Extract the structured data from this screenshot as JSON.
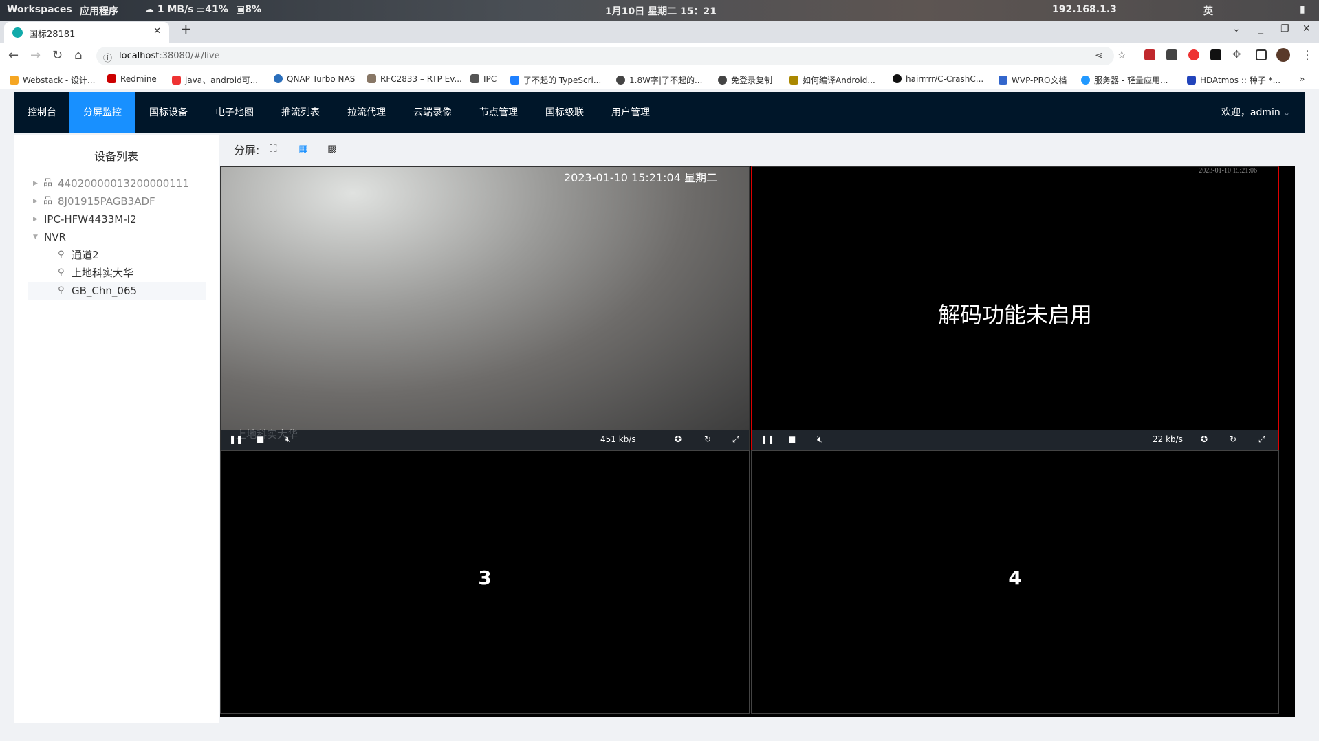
{
  "system_bar": {
    "workspaces": "Workspaces",
    "apps": "应用程序",
    "net": "1 MB/s",
    "cpu": "41%",
    "mem": "8%",
    "clock": "1月10日 星期二 15：21",
    "ip": "192.168.1.3",
    "ime": "英"
  },
  "browser": {
    "tab_title": "国标28181",
    "url_host": "localhost",
    "url_rest": ":38080/#/live",
    "bookmarks": [
      "Webstack - 设计...",
      "Redmine",
      "java、android可...",
      "QNAP Turbo NAS",
      "RFC2833 – RTP Ev...",
      "IPC",
      "了不起的 TypeScri...",
      "1.8W字|了不起的...",
      "免登录复制",
      "如何编译Android...",
      "hairrrrr/C-CrashC...",
      "WVP-PRO文档",
      "服务器 - 轻量应用...",
      "HDAtmos :: 种子 *..."
    ],
    "bookmarks_more": "»"
  },
  "nav": {
    "items": [
      "控制台",
      "分屏监控",
      "国标设备",
      "电子地图",
      "推流列表",
      "拉流代理",
      "云端录像",
      "节点管理",
      "国标级联",
      "用户管理"
    ],
    "active": 1,
    "welcome": "欢迎，admin"
  },
  "sidebar": {
    "title": "设备列表",
    "tree": [
      {
        "label": "44020000013200000111",
        "offline": true
      },
      {
        "label": "8J01915PAGB3ADF",
        "offline": true
      },
      {
        "label": "IPC-HFW4433M-I2"
      },
      {
        "label": "NVR",
        "expanded": true
      },
      {
        "label": "通道2"
      },
      {
        "label": "上地科实大华"
      },
      {
        "label": "GB_Chn_065",
        "selected": true
      }
    ]
  },
  "split": {
    "label": "分屏:"
  },
  "players": [
    {
      "osd_time": "2023-01-10 15:21:04 星期二",
      "osd_name": "上地科实大华",
      "bitrate": "451 kb/s"
    },
    {
      "osd_time": "2023-01-10 15:21:06",
      "message": "解码功能未启用",
      "bitrate": "22 kb/s"
    },
    {
      "index": "3"
    },
    {
      "index": "4"
    }
  ]
}
